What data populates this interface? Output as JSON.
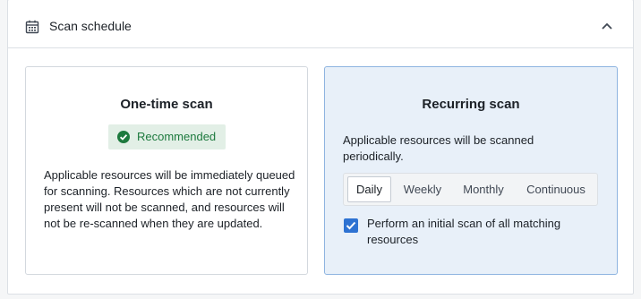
{
  "header": {
    "title": "Scan schedule",
    "icon": "calendar-icon",
    "collapse_icon": "chevron-up-icon"
  },
  "one_time": {
    "title": "One-time scan",
    "badge": "Recommended",
    "badge_icon": "check-circle-icon",
    "description": "Applicable resources will be immediately queued for scanning. Resources which are not currently present will not be scanned, and resources will not be re-scanned when they are updated.",
    "selected": false
  },
  "recurring": {
    "title": "Recurring scan",
    "description": "Applicable resources will be scanned periodically.",
    "selected": true,
    "frequency_options": [
      "Daily",
      "Weekly",
      "Monthly",
      "Continuous"
    ],
    "selected_frequency": "Daily",
    "initial_scan": {
      "label": "Perform an initial scan of all matching resources",
      "checked": true
    }
  },
  "colors": {
    "accent": "#2d72d2",
    "success": "#1d7a3e",
    "selected_card_bg": "#e8f0f9"
  }
}
